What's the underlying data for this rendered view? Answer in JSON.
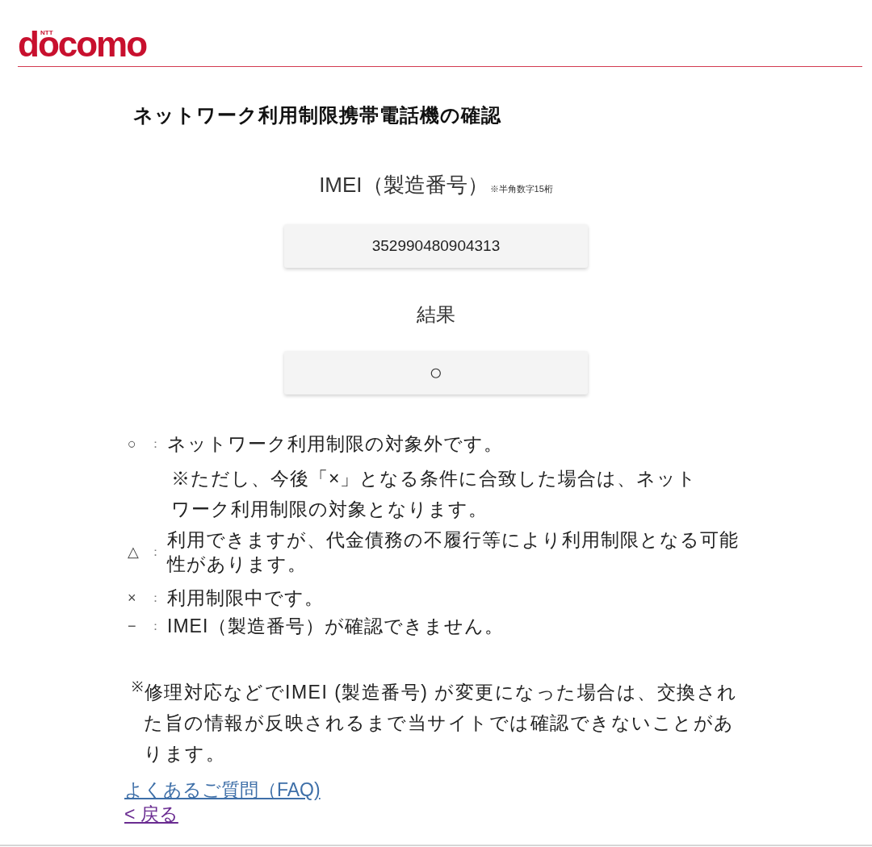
{
  "header": {
    "logo_small": "NTT",
    "logo": "docomo"
  },
  "page_title": "ネットワーク利用制限携帯電話機の確認",
  "imei": {
    "label": "IMEI（製造番号）",
    "note": "※半角数字15桁",
    "value": "352990480904313"
  },
  "result": {
    "label": "結果",
    "value": "○"
  },
  "legend": [
    {
      "symbol": "○",
      "separator": "：",
      "text": "ネットワーク利用制限の対象外です。",
      "note": "※ただし、今後「×」となる条件に合致した場合は、ネットワーク利用制限の対象となります。"
    },
    {
      "symbol": "△",
      "separator": "：",
      "text": "利用できますが、代金債務の不履行等により利用制限となる可能性があります。"
    },
    {
      "symbol": "×",
      "separator": "：",
      "text": "利用制限中です。"
    },
    {
      "symbol": "−",
      "separator": "：",
      "text": "IMEI（製造番号）が確認できません。"
    }
  ],
  "footnote": "$^{※}$修理対応などでIMEI (製造番号) が変更になった場合は、交換された旨の情報が反映されるまで当サイトでは確認できないことがあります。",
  "links": [
    {
      "label": "よくあるご質問（FAQ)",
      "visited": false
    },
    {
      "label": "< 戻る",
      "visited": true
    }
  ]
}
